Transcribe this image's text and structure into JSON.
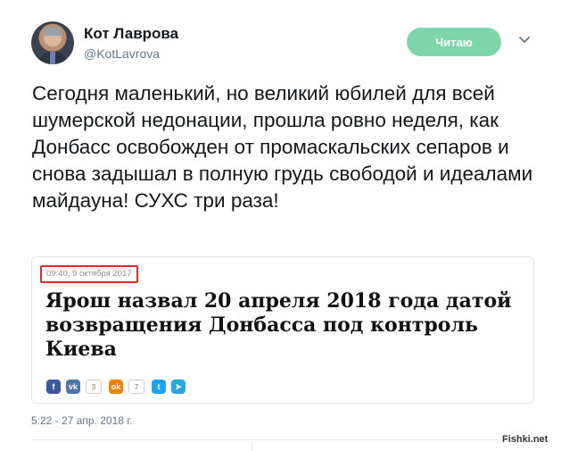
{
  "author": {
    "name": "Кот Лаврова",
    "handle": "@KotLavrova"
  },
  "follow_button": {
    "label": "Читаю",
    "color": "#7dd6a9"
  },
  "tweet": {
    "text": "Сегодня маленький, но великий юбилей для всей шумерской недонации, прошла ровно неделя, как Донбасс освобожден от промаскальских сепаров и снова задышал в полную грудь свободой и идеалами майдауна! СУХС три раза!",
    "timestamp": "5:22 - 27 апр. 2018 г."
  },
  "card": {
    "date": "09:40, 9 октября 2017",
    "date_highlight_color": "#d32f2f",
    "headline": "Ярош назвал 20 апреля 2018 года датой возвращения Донбасса под контроль Киева",
    "share": [
      {
        "icon": "facebook-icon",
        "glyph": "f",
        "color": "#3b5998"
      },
      {
        "icon": "vk-icon",
        "glyph": "vk",
        "color": "#4a76a8",
        "count": "3"
      },
      {
        "icon": "odnoklassniki-icon",
        "glyph": "ok",
        "color": "#ee8208",
        "count": "7"
      },
      {
        "icon": "twitter-icon",
        "glyph": "t",
        "color": "#1da1f2"
      },
      {
        "icon": "telegram-icon",
        "glyph": "➤",
        "color": "#2ca5e0"
      }
    ]
  },
  "watermark": "Fishki.net"
}
